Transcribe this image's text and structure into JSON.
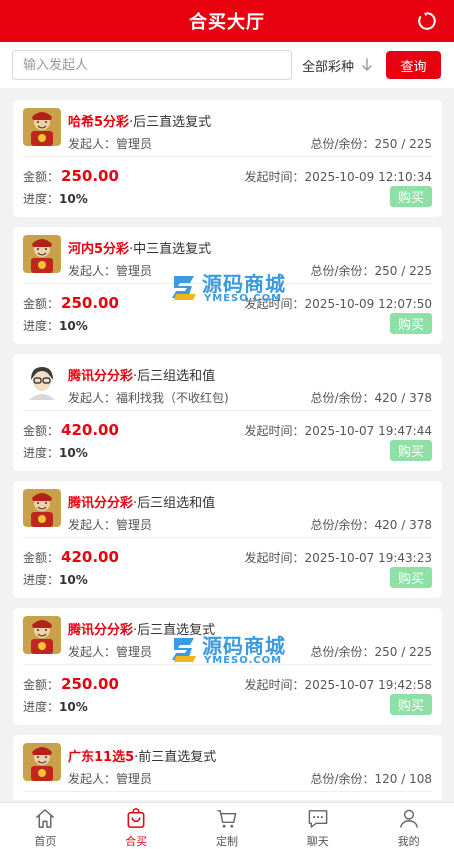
{
  "header": {
    "title": "合买大厅"
  },
  "search": {
    "placeholder": "输入发起人",
    "filter_label": "全部彩种",
    "query_label": "查询"
  },
  "labels": {
    "initiator_prefix": "发起人：",
    "shares_prefix": "总份/余份：",
    "amount_prefix": "金额：",
    "time_prefix": "发起时间：",
    "progress_prefix": "进度：",
    "buy": "购买"
  },
  "watermark": {
    "cn": "源码商城",
    "en": "YMESO.COM"
  },
  "orders": [
    {
      "lottery": "哈希5分彩",
      "play": "·后三直选复式",
      "initiator": "管理员",
      "shares": "250 / 225",
      "amount": "250.00",
      "time": "2025-10-09 12:10:34",
      "progress": "10%",
      "avatar": "deity"
    },
    {
      "lottery": "河内5分彩",
      "play": "·中三直选复式",
      "initiator": "管理员",
      "shares": "250 / 225",
      "amount": "250.00",
      "time": "2025-10-09 12:07:50",
      "progress": "10%",
      "avatar": "deity"
    },
    {
      "lottery": "腾讯分分彩",
      "play": "·后三组选和值",
      "initiator": "福利找我（不收红包)",
      "shares": "420 / 378",
      "amount": "420.00",
      "time": "2025-10-07 19:47:44",
      "progress": "10%",
      "avatar": "person"
    },
    {
      "lottery": "腾讯分分彩",
      "play": "·后三组选和值",
      "initiator": "管理员",
      "shares": "420 / 378",
      "amount": "420.00",
      "time": "2025-10-07 19:43:23",
      "progress": "10%",
      "avatar": "deity"
    },
    {
      "lottery": "腾讯分分彩",
      "play": "·后三直选复式",
      "initiator": "管理员",
      "shares": "250 / 225",
      "amount": "250.00",
      "time": "2025-10-07 19:42:58",
      "progress": "10%",
      "avatar": "deity"
    },
    {
      "lottery": "广东11选5",
      "play": "·前三直选复式",
      "initiator": "管理员",
      "shares": "120 / 108",
      "amount": "",
      "time": "",
      "progress": "",
      "avatar": "deity"
    }
  ],
  "tabs": [
    {
      "label": "首页",
      "icon": "home-icon",
      "active": false
    },
    {
      "label": "合买",
      "icon": "bag-icon",
      "active": true
    },
    {
      "label": "定制",
      "icon": "cart-icon",
      "active": false
    },
    {
      "label": "聊天",
      "icon": "chat-icon",
      "active": false
    },
    {
      "label": "我的",
      "icon": "user-icon",
      "active": false
    }
  ],
  "colors": {
    "brand": "#e8020f",
    "buy_button": "#8fe0a6",
    "watermark": "#3a9be0"
  }
}
